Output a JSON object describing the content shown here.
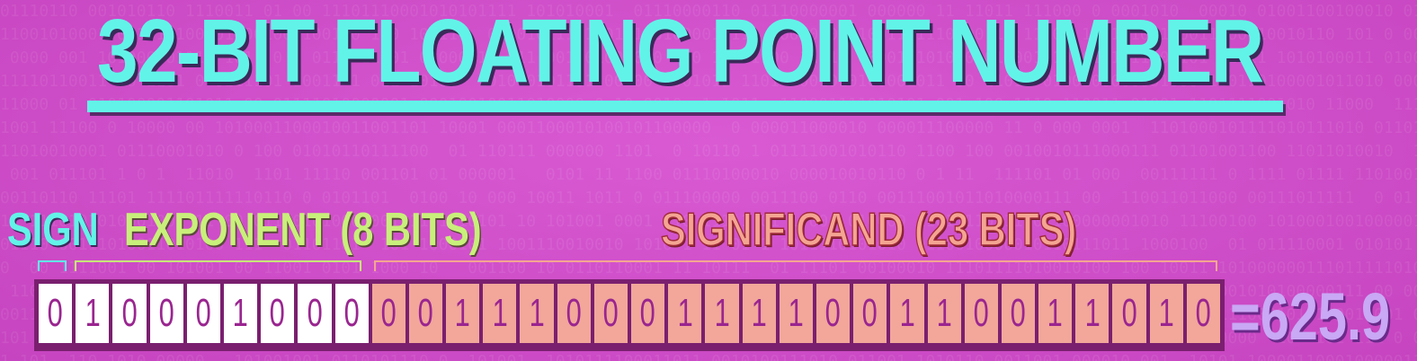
{
  "title": "32-BIT FLOATING POINT NUMBER",
  "labels": {
    "sign": "SIGN",
    "exponent": "EXPONENT (8 BITS)",
    "significand": "SIGNIFICAND (23 BITS)"
  },
  "bits": {
    "sign": [
      "0"
    ],
    "exponent": [
      "1",
      "0",
      "0",
      "0",
      "1",
      "0",
      "0",
      "0"
    ],
    "significand": [
      "0",
      "0",
      "1",
      "1",
      "1",
      "0",
      "0",
      "0",
      "1",
      "1",
      "1",
      "1",
      "0",
      "0",
      "1",
      "1",
      "0",
      "0",
      "1",
      "1",
      "0",
      "1",
      "0"
    ]
  },
  "result": "=625.9",
  "colors": {
    "background": "#d050c8",
    "title": "#62f3e8",
    "exponent": "#c8f07a",
    "significand": "#f4a592",
    "result": "#c9a8f5"
  }
}
